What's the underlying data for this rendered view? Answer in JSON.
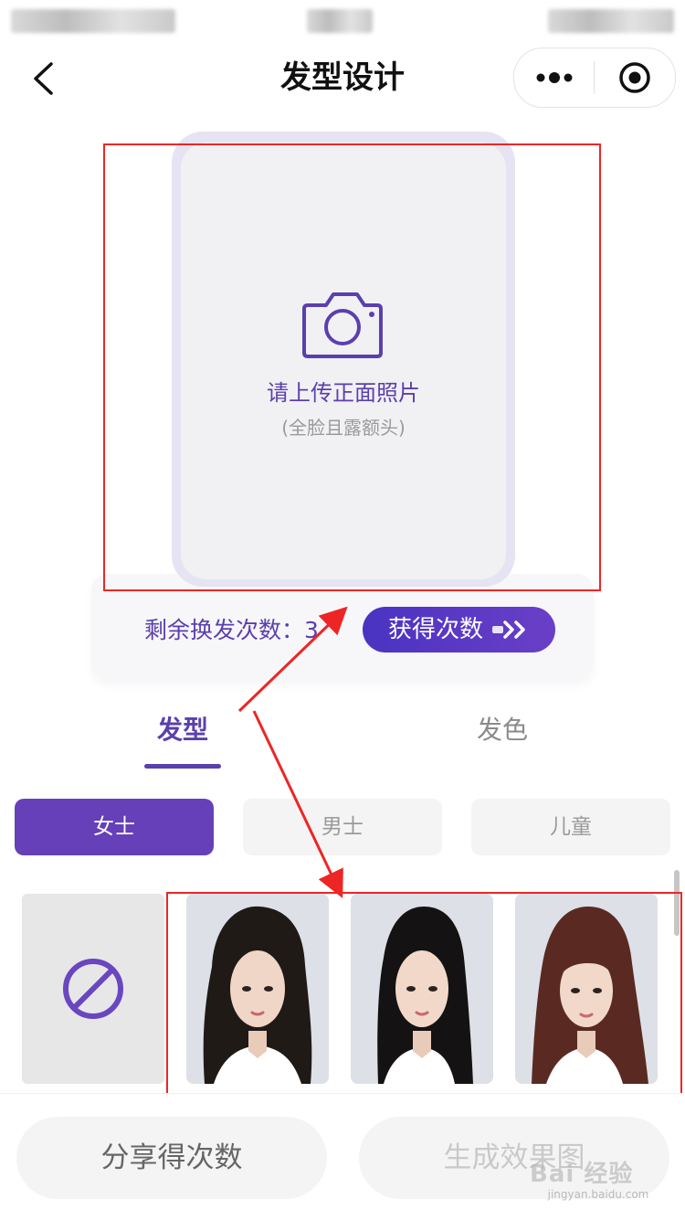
{
  "nav": {
    "title": "发型设计",
    "back_icon": "chevron-left-icon",
    "more_icon": "more-dots-icon",
    "close_icon": "target-close-icon"
  },
  "upload": {
    "title": "请上传正面照片",
    "hint": "(全脸且露额头)",
    "icon": "camera-icon"
  },
  "quota": {
    "label": "剩余换发次数：",
    "value": "3",
    "get_button": "获得次数"
  },
  "tabs": [
    {
      "label": "发型",
      "active": true
    },
    {
      "label": "发色",
      "active": false
    }
  ],
  "gender_filters": [
    {
      "label": "女士",
      "active": true
    },
    {
      "label": "男士",
      "active": false
    },
    {
      "label": "儿童",
      "active": false
    }
  ],
  "hairstyles": [
    {
      "name": "none",
      "icon": "no-style-icon"
    },
    {
      "name": "long-wavy-black"
    },
    {
      "name": "long-straight-black"
    },
    {
      "name": "long-auburn-bangs"
    }
  ],
  "bottom": {
    "share_button": "分享得次数",
    "generate_button": "生成效果图"
  },
  "watermark": {
    "brand": "Bai 经验",
    "url": "jingyan.baidu.com"
  },
  "colors": {
    "accent": "#5b3fae",
    "annotation": "#ee2525"
  }
}
